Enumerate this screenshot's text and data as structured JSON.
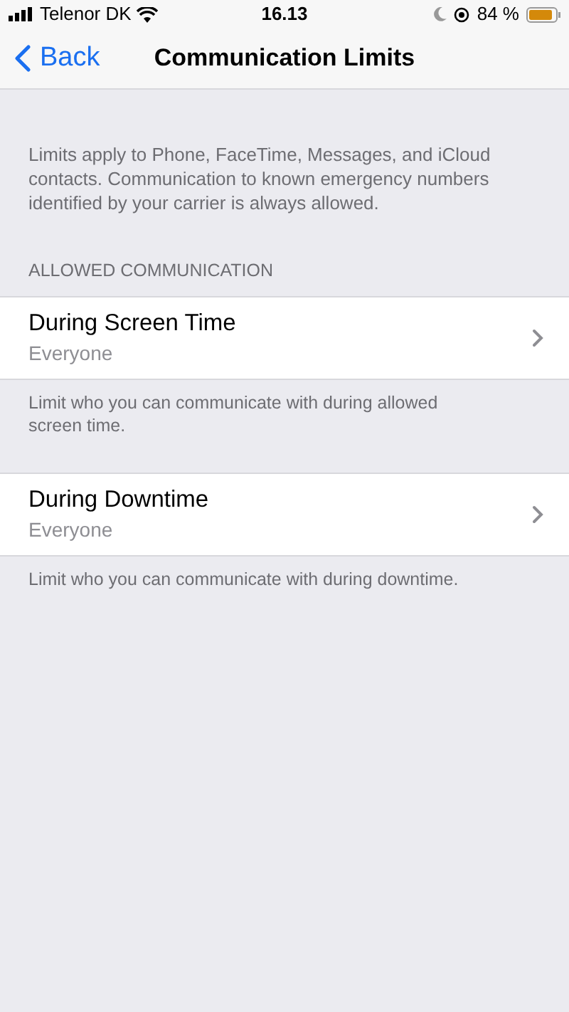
{
  "status_bar": {
    "carrier": "Telenor DK",
    "time": "16.13",
    "battery": "84 %"
  },
  "nav": {
    "back": "Back",
    "title": "Communication Limits"
  },
  "intro": "Limits apply to Phone, FaceTime, Messages, and iCloud contacts. Communication to known emergency numbers identified by your carrier is always allowed.",
  "sections": [
    {
      "header": "ALLOWED COMMUNICATION",
      "rows": [
        {
          "title": "During Screen Time",
          "value": "Everyone"
        }
      ],
      "footer": "Limit who you can communicate with during allowed screen time."
    },
    {
      "rows": [
        {
          "title": "During Downtime",
          "value": "Everyone"
        }
      ],
      "footer": "Limit who you can communicate with during downtime."
    }
  ]
}
